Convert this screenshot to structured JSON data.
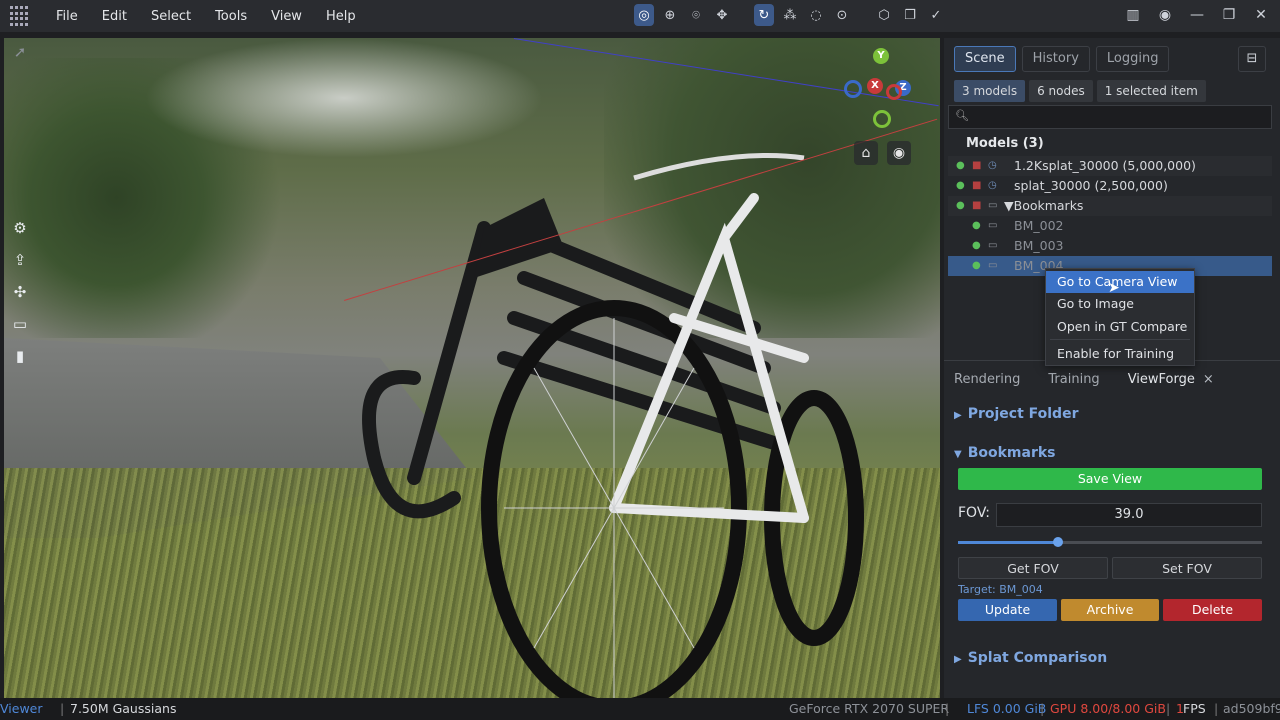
{
  "menu": [
    "File",
    "Edit",
    "Select",
    "Tools",
    "View",
    "Help"
  ],
  "toolbar_icons": [
    "orbit-icon",
    "globe-icon",
    "focus-icon",
    "move-icon",
    "rotate-icon",
    "nodes-icon",
    "lasso-icon",
    "target-icon",
    "cube-icon",
    "copy-icon",
    "check-icon"
  ],
  "scene_tabs": {
    "scene": "Scene",
    "history": "History",
    "logging": "Logging"
  },
  "chips": {
    "models": "3 models",
    "nodes": "6 nodes",
    "selected": "1 selected item"
  },
  "search": {
    "placeholder": ""
  },
  "models_title": "Models (3)",
  "tree": [
    {
      "label": "1.2Ksplat_30000 (5,000,000)"
    },
    {
      "label": "splat_30000 (2,500,000)"
    },
    {
      "label": "▼Bookmarks"
    },
    {
      "label": "BM_002"
    },
    {
      "label": "BM_003"
    },
    {
      "label": "BM_004"
    }
  ],
  "context_menu": [
    "Go to Camera View",
    "Go to Image",
    "Open in GT Compare",
    "Enable for Training"
  ],
  "bottom_tabs": {
    "rendering": "Rendering",
    "training": "Training",
    "viewforge": "ViewForge",
    "close": "×"
  },
  "sections": {
    "project_folder": "Project Folder",
    "bookmarks": "Bookmarks",
    "splat_comparison": "Splat Comparison"
  },
  "bookmarks_panel": {
    "save_view": "Save View",
    "fov_label": "FOV:",
    "fov_value": "39.0",
    "fov_slider_fraction": 0.33,
    "get_fov": "Get FOV",
    "set_fov": "Set FOV",
    "target": "Target: BM_004",
    "update": "Update",
    "archive": "Archive",
    "delete": "Delete"
  },
  "gizmo": {
    "y": "Y",
    "z": "Z",
    "x": "X"
  },
  "status": {
    "mode": "Viewer",
    "gaussians": "7.50M Gaussians",
    "gpu_name": "GeForce RTX 2070 SUPER",
    "lfs": "LFS 0.00 GiB",
    "gpu_mem": "GPU 8.00/8.00 GiB",
    "fps_value": "1",
    "fps_label": "FPS",
    "commit": "ad509bf9"
  },
  "colors": {
    "accent": "#3b72c7",
    "save": "#2fb84a",
    "update": "#3567b0",
    "archive": "#c08a2e",
    "delete": "#b3262d",
    "gpu_warn": "#e0483f"
  }
}
